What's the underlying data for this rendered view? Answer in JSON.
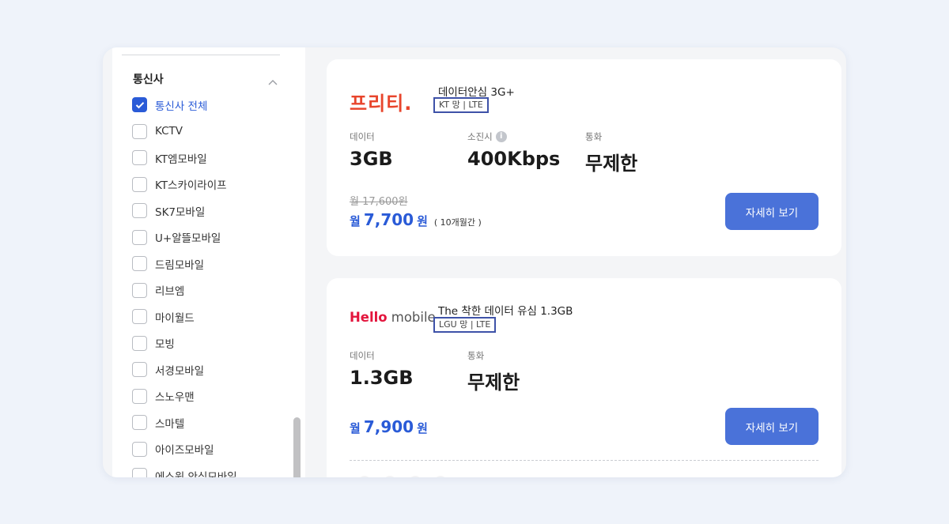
{
  "filter": {
    "title": "통신사",
    "carriers": [
      {
        "label": "통신사 전체",
        "checked": true
      },
      {
        "label": "KCTV",
        "checked": false
      },
      {
        "label": "KT엠모바일",
        "checked": false
      },
      {
        "label": "KT스카이라이프",
        "checked": false
      },
      {
        "label": "SK7모바일",
        "checked": false
      },
      {
        "label": "U+알뜰모바일",
        "checked": false
      },
      {
        "label": "드림모바일",
        "checked": false
      },
      {
        "label": "리브엠",
        "checked": false
      },
      {
        "label": "마이월드",
        "checked": false
      },
      {
        "label": "모빙",
        "checked": false
      },
      {
        "label": "서경모바일",
        "checked": false
      },
      {
        "label": "스노우맨",
        "checked": false
      },
      {
        "label": "스마텔",
        "checked": false
      },
      {
        "label": "아이즈모바일",
        "checked": false
      },
      {
        "label": "에스원 안심모바일",
        "checked": false
      }
    ]
  },
  "plans": [
    {
      "brand": "프리티.",
      "brand_color": "#e8452c",
      "name": "데이터안심 3G+",
      "network": "KT 망 | LTE",
      "specs": [
        {
          "label": "데이터",
          "value": "3GB"
        },
        {
          "label": "소진시",
          "value": "400Kbps",
          "info_icon": "i"
        },
        {
          "label": "통화",
          "value": "무제한"
        }
      ],
      "original_price": "월 17,600원",
      "price_prefix": "월",
      "price": "7,700",
      "price_unit": "원",
      "price_period": "( 10개월간 )",
      "button": "자세히 보기"
    },
    {
      "brand_parts": [
        "Hello",
        "mobile"
      ],
      "brand_colors": [
        "#e3153d",
        "#555555"
      ],
      "name": "The 착한 데이터 유심 1.3GB",
      "network": "LGU 망 | LTE",
      "specs": [
        {
          "label": "데이터",
          "value": "1.3GB"
        },
        {
          "label": "통화",
          "value": "무제한"
        }
      ],
      "price_prefix": "월",
      "price": "7,900",
      "price_unit": "원",
      "button": "자세히 보기"
    }
  ],
  "colors": {
    "accent": "#2a5bd7",
    "button": "#4a72d9",
    "tag_border": "#3e52a8"
  }
}
